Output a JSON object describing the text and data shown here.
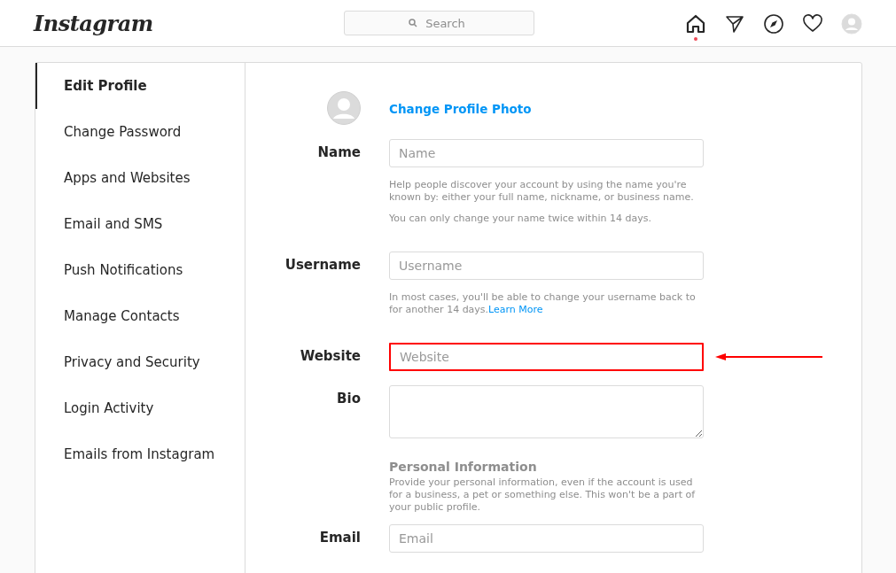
{
  "header": {
    "logo": "Instagram",
    "search": {
      "placeholder": "Search"
    },
    "nav": [
      {
        "kind": "home",
        "selected": true,
        "notification": true
      },
      {
        "kind": "send",
        "selected": false,
        "notification": false
      },
      {
        "kind": "compass",
        "selected": false,
        "notification": false
      },
      {
        "kind": "heart",
        "selected": false,
        "notification": false
      },
      {
        "kind": "avatar",
        "selected": false,
        "notification": false
      }
    ]
  },
  "sidebar": {
    "items": [
      {
        "label": "Edit Profile",
        "selected": true
      },
      {
        "label": "Change Password",
        "selected": false
      },
      {
        "label": "Apps and Websites",
        "selected": false
      },
      {
        "label": "Email and SMS",
        "selected": false
      },
      {
        "label": "Push Notifications",
        "selected": false
      },
      {
        "label": "Manage Contacts",
        "selected": false
      },
      {
        "label": "Privacy and Security",
        "selected": false
      },
      {
        "label": "Login Activity",
        "selected": false
      },
      {
        "label": "Emails from Instagram",
        "selected": false
      }
    ]
  },
  "form": {
    "rows": [
      {
        "kind": "photo",
        "link": "Change Profile Photo"
      },
      {
        "kind": "input",
        "label": "Name",
        "placeholder": "Name",
        "highlighted": false,
        "hints": [
          {
            "text": "Help people discover your account by using the name you're known by: either your full name, nickname, or business name."
          },
          {
            "text": "You can only change your name twice within 14 days."
          }
        ]
      },
      {
        "kind": "input",
        "label": "Username",
        "placeholder": "Username",
        "highlighted": false,
        "hints": [
          {
            "text": "In most cases, you'll be able to change your username back to for another 14 days.",
            "link": "Learn More"
          }
        ]
      },
      {
        "kind": "input",
        "label": "Website",
        "placeholder": "Website",
        "highlighted": true
      },
      {
        "kind": "textarea",
        "label": "Bio",
        "highlighted": false
      },
      {
        "kind": "section",
        "title": "Personal Information",
        "text": "Provide your personal information, even if the account is used for a business, a pet or something else. This won't be a part of your public profile."
      },
      {
        "kind": "input",
        "label": "Email",
        "placeholder": "Email",
        "highlighted": false
      }
    ]
  }
}
